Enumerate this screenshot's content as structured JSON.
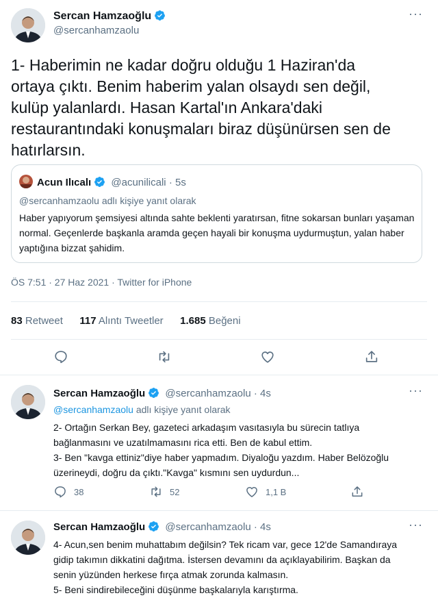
{
  "main_tweet": {
    "author": "Sercan Hamzaoğlu",
    "handle": "@sercanhamzaolu",
    "text": "1- Haberimin ne kadar doğru olduğu 1 Haziran'da ortaya çıktı. Benim haberim yalan olsaydı sen değil, kulüp yalanlardı. Hasan Kartal'ın Ankara'daki restaurantındaki konuşmaları biraz düşünürsen sen de hatırlarsın.",
    "quoted": {
      "author": "Acun Ilıcalı",
      "handle": "@acunilicali",
      "time": "· 5s",
      "reply_to": "@sercanhamzaolu adlı kişiye yanıt olarak",
      "text": "Haber yapıyorum şemsiyesi altında sahte beklenti yaratırsan, fitne sokarsan bunları yaşaman normal. Geçenlerde başkanla aramda geçen hayali bir konuşma uydurmuştun, yalan haber yaptığına bizzat şahidim."
    },
    "timestamp": "ÖS 7:51 · 27 Haz 2021 · Twitter for iPhone",
    "stats": {
      "retweets": "83",
      "retweets_label": "Retweet",
      "quotes": "117",
      "quotes_label": "Alıntı Tweetler",
      "likes": "1.685",
      "likes_label": "Beğeni"
    }
  },
  "replies": [
    {
      "author": "Sercan Hamzaoğlu",
      "handle": "@sercanhamzaolu · 4s",
      "reply_to_handle": "@sercanhamzaolu",
      "reply_to_suffix": " adlı kişiye yanıt olarak",
      "text": "2- Ortağın Serkan Bey, gazeteci arkadaşım vasıtasıyla bu sürecin tatlıya bağlanmasını ve uzatılmamasını rica etti. Ben de kabul ettim.\n3- Ben \"kavga ettiniz\"diye haber yapmadım. Diyaloğu yazdım. Haber Belözoğlu üzerineydi, doğru da çıktı.\"Kavga\" kısmını sen uydurdun...",
      "replies": "38",
      "retweets": "52",
      "likes": "1,1 B"
    },
    {
      "author": "Sercan Hamzaoğlu",
      "handle": "@sercanhamzaolu · 4s",
      "text": "4- Acun,sen benim muhattabım değilsin? Tek ricam var, gece 12'de Samandıraya gidip takımın dikkatini dağıtma. İstersen devamını da açıklayabilirim. Başkan da senin yüzünden herkese fırça atmak zorunda kalmasın.\n5- Beni sindirebileceğini düşünme başkalarıyla karıştırma."
    }
  ],
  "colors": {
    "verified": "#1da1f2",
    "link": "#1b95e0",
    "muted": "#5b7083",
    "divider": "#e6ecf0"
  }
}
